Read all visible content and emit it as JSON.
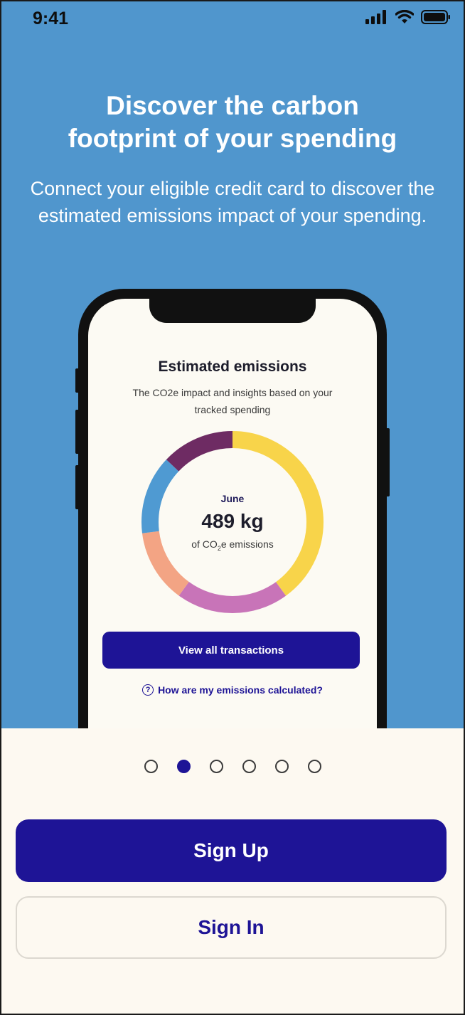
{
  "status_bar": {
    "time": "9:41",
    "icons": [
      "signal-icon",
      "wifi-icon",
      "battery-icon"
    ]
  },
  "hero": {
    "headline_line1": "Discover the carbon",
    "headline_line2": "footprint of your spending",
    "subhead": "Connect your eligible credit card to discover the estimated emissions impact of your spending.",
    "background_color": "#5096cd"
  },
  "phone_screen": {
    "title": "Estimated emissions",
    "subtitle": "The CO2e impact and insights based on your tracked spending",
    "chart": {
      "month": "June",
      "value": "489 kg",
      "unit_prefix": "of CO",
      "unit_sub": "2",
      "unit_suffix": "e emissions",
      "segments": [
        {
          "color": "#f8d44a",
          "fraction": 0.4
        },
        {
          "color": "#c874b8",
          "fraction": 0.2
        },
        {
          "color": "#f3a484",
          "fraction": 0.13
        },
        {
          "color": "#4f9ad2",
          "fraction": 0.14
        },
        {
          "color": "#6e2b63",
          "fraction": 0.13
        }
      ]
    },
    "view_button_label": "View all transactions",
    "help_icon": "question-circle-icon",
    "help_link_label": "How are my emissions calculated?"
  },
  "pagination": {
    "count": 6,
    "active_index": 1
  },
  "actions": {
    "sign_up_label": "Sign Up",
    "sign_in_label": "Sign In"
  },
  "colors": {
    "primary": "#1e1496",
    "page_background": "#fdf9f1"
  }
}
